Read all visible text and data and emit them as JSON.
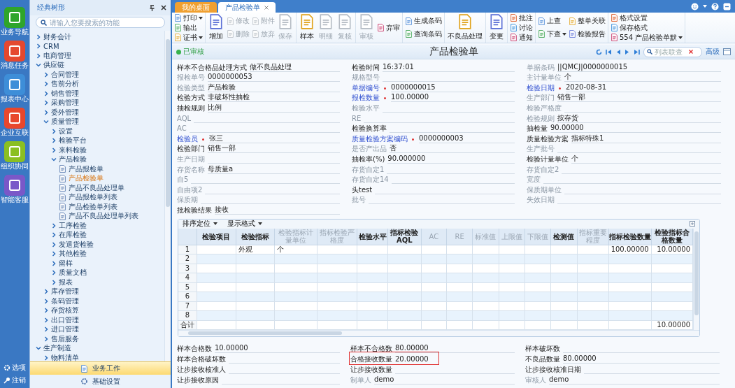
{
  "rail": {
    "items": [
      {
        "label": "业务导航",
        "color": "#2fa52a"
      },
      {
        "label": "消息任务",
        "color": "#e5482f"
      },
      {
        "label": "报表中心",
        "color": "#3e8ed8"
      },
      {
        "label": "企业互联",
        "color": "#e8472c"
      },
      {
        "label": "组织协同",
        "color": "#8bbf22"
      },
      {
        "label": "智能客服",
        "color": "#7a58c8"
      }
    ],
    "footer": [
      {
        "label": "选项",
        "kind": "gear"
      },
      {
        "label": "注销",
        "kind": "key"
      }
    ]
  },
  "tree_panel": {
    "title": "经典树形",
    "search": {
      "placeholder": "请输入您要搜索的功能"
    },
    "items": [
      {
        "label": "财务会计",
        "kind": "folder",
        "expanded": false,
        "selected": false
      },
      {
        "label": "CRM",
        "kind": "folder",
        "expanded": false,
        "selected": false
      },
      {
        "label": "电商管理",
        "kind": "folder",
        "expanded": false,
        "selected": false
      },
      {
        "label": "供应链",
        "kind": "folder",
        "expanded": true,
        "selected": false,
        "children": [
          {
            "label": "合同管理",
            "kind": "folder",
            "expanded": false,
            "selected": false
          },
          {
            "label": "售前分析",
            "kind": "folder",
            "expanded": false,
            "selected": false
          },
          {
            "label": "销售管理",
            "kind": "folder",
            "expanded": false,
            "selected": false
          },
          {
            "label": "采购管理",
            "kind": "folder",
            "expanded": false,
            "selected": false
          },
          {
            "label": "委外管理",
            "kind": "folder",
            "expanded": false,
            "selected": false
          },
          {
            "label": "质量管理",
            "kind": "folder",
            "expanded": true,
            "selected": false,
            "children": [
              {
                "label": "设置",
                "kind": "folder",
                "expanded": false,
                "selected": false
              },
              {
                "label": "检验平台",
                "kind": "folder",
                "expanded": false,
                "selected": false
              },
              {
                "label": "来料检验",
                "kind": "folder",
                "expanded": false,
                "selected": false
              },
              {
                "label": "产品检验",
                "kind": "folder",
                "expanded": true,
                "selected": false,
                "children": [
                  {
                    "label": "产品报检单",
                    "kind": "document",
                    "selected": false
                  },
                  {
                    "label": "产品检验单",
                    "kind": "document",
                    "selected": true
                  },
                  {
                    "label": "产品不良品处理单",
                    "kind": "document",
                    "selected": false
                  },
                  {
                    "label": "产品报检单列表",
                    "kind": "document",
                    "selected": false
                  },
                  {
                    "label": "产品检验单列表",
                    "kind": "document",
                    "selected": false
                  },
                  {
                    "label": "产品不良品处理单列表",
                    "kind": "document",
                    "selected": false
                  }
                ]
              },
              {
                "label": "工序检验",
                "kind": "folder",
                "expanded": false,
                "selected": false
              },
              {
                "label": "在库检验",
                "kind": "folder",
                "expanded": false,
                "selected": false
              },
              {
                "label": "发退货检验",
                "kind": "folder",
                "expanded": false,
                "selected": false
              },
              {
                "label": "其他检验",
                "kind": "folder",
                "expanded": false,
                "selected": false
              },
              {
                "label": "留样",
                "kind": "folder",
                "expanded": false,
                "selected": false
              },
              {
                "label": "质量文档",
                "kind": "folder",
                "expanded": false,
                "selected": false
              },
              {
                "label": "报表",
                "kind": "folder",
                "expanded": false,
                "selected": false
              }
            ]
          },
          {
            "label": "库存管理",
            "kind": "folder",
            "expanded": false,
            "selected": false
          },
          {
            "label": "条码管理",
            "kind": "folder",
            "expanded": false,
            "selected": false
          },
          {
            "label": "存货核算",
            "kind": "folder",
            "expanded": false,
            "selected": false
          },
          {
            "label": "出口管理",
            "kind": "folder",
            "expanded": false,
            "selected": false
          },
          {
            "label": "进口管理",
            "kind": "folder",
            "expanded": false,
            "selected": false
          },
          {
            "label": "售后服务",
            "kind": "folder",
            "expanded": false,
            "selected": false
          }
        ]
      },
      {
        "label": "生产制造",
        "kind": "folder",
        "expanded": true,
        "selected": false,
        "children": [
          {
            "label": "物料清单",
            "kind": "folder",
            "expanded": false,
            "selected": false
          }
        ]
      }
    ],
    "buttons": [
      {
        "label": "业务工作",
        "selected": true
      },
      {
        "label": "基础设置",
        "selected": false
      }
    ]
  },
  "tabs": [
    {
      "label": "我的桌面",
      "selected": false
    },
    {
      "label": "产品检验单",
      "selected": true
    }
  ],
  "toolbar": [
    [
      [
        {
          "label": "打印",
          "kind": "menu",
          "disabled": false
        },
        {
          "label": "输出",
          "kind": "small",
          "disabled": false
        },
        {
          "label": "证书",
          "kind": "menu",
          "disabled": false
        }
      ]
    ],
    [
      [
        {
          "label": "增加",
          "kind": "big",
          "disabled": false
        }
      ],
      [
        {
          "label": "修改",
          "kind": "small",
          "disabled": true
        },
        {
          "label": "删除",
          "kind": "small",
          "disabled": true
        }
      ],
      [
        {
          "label": "附件",
          "kind": "small",
          "disabled": true
        },
        {
          "label": "放弃",
          "kind": "small",
          "disabled": true
        }
      ],
      [
        {
          "label": "保存",
          "kind": "big",
          "disabled": true
        }
      ]
    ],
    [
      [
        {
          "label": "样本",
          "kind": "big",
          "disabled": false
        }
      ],
      [
        {
          "label": "明细",
          "kind": "big",
          "disabled": true
        }
      ],
      [
        {
          "label": "复核",
          "kind": "big",
          "disabled": true
        }
      ]
    ],
    [
      [
        {
          "label": "审核",
          "kind": "big",
          "disabled": true
        }
      ],
      [
        {
          "label": "弃审",
          "kind": "small",
          "disabled": false
        }
      ]
    ],
    [
      [
        {
          "label": "生成条码",
          "kind": "small",
          "disabled": false
        },
        {
          "label": "查询条码",
          "kind": "small",
          "disabled": false
        }
      ]
    ],
    [
      [
        {
          "label": "不良品处理",
          "kind": "big",
          "disabled": false
        }
      ]
    ],
    [
      [
        {
          "label": "变更",
          "kind": "big",
          "disabled": false
        }
      ]
    ],
    [
      [
        {
          "label": "批注",
          "kind": "small",
          "disabled": false
        },
        {
          "label": "讨论",
          "kind": "small",
          "disabled": false
        },
        {
          "label": "通知",
          "kind": "small",
          "disabled": false
        }
      ]
    ],
    [
      [
        {
          "label": "上查",
          "kind": "small",
          "disabled": false
        },
        {
          "label": "下查",
          "kind": "menu",
          "disabled": false
        }
      ],
      [
        {
          "label": "整单关联",
          "kind": "small",
          "disabled": false
        },
        {
          "label": "检验报告",
          "kind": "small",
          "disabled": false
        }
      ]
    ],
    [
      [
        {
          "label": "格式设置",
          "kind": "small",
          "disabled": false
        },
        {
          "label": "保存格式",
          "kind": "small",
          "disabled": false
        },
        {
          "label": "554 产品检验单默",
          "kind": "menu",
          "disabled": false
        }
      ]
    ]
  ],
  "title_bar": {
    "status": "已审核",
    "title": "产品检验单",
    "search": {
      "placeholder": "列表联查"
    },
    "advanced": "高级"
  },
  "form": {
    "columns": [
      [
        {
          "label": "样本不合格品处理方式",
          "value": "做不良品处理",
          "kind": "strong"
        },
        {
          "label": "报检单号",
          "value": "0000000053",
          "kind": "plain"
        },
        {
          "label": "检验类型",
          "value": "产品检验",
          "kind": "plain"
        },
        {
          "label": "检验方式",
          "value": "非破坏性抽检",
          "kind": "strong"
        },
        {
          "label": "抽检规则",
          "value": "比例",
          "kind": "strong"
        },
        {
          "label": "AQL",
          "kind": "plain"
        },
        {
          "label": "AC",
          "kind": "plain"
        },
        {
          "label": "检验员",
          "value": "张三",
          "kind": "required"
        },
        {
          "label": "检验部门",
          "value": "销售一部",
          "kind": "strong"
        },
        {
          "label": "生产日期",
          "kind": "plain"
        },
        {
          "label": "存货名称",
          "value": "母质量a",
          "kind": "plain"
        },
        {
          "label": "自5",
          "kind": "plain"
        },
        {
          "label": "自由项2",
          "kind": "plain"
        },
        {
          "label": "保质期",
          "kind": "plain"
        },
        {
          "label": "批检验结果",
          "value": "接收",
          "kind": "strong"
        }
      ],
      [
        {
          "label": "检验时间",
          "value": "16:37:01",
          "kind": "strong"
        },
        {
          "label": "规格型号",
          "kind": "plain"
        },
        {
          "label": "单据编号",
          "value": "0000000015",
          "kind": "required"
        },
        {
          "label": "报检数量",
          "value": "100.00000",
          "kind": "required"
        },
        {
          "label": "检验水平",
          "kind": "plain"
        },
        {
          "label": "RE",
          "kind": "plain"
        },
        {
          "label": "检验换算率",
          "kind": "strong"
        },
        {
          "label": "质量检验方案编码",
          "value": "0000000003",
          "kind": "required"
        },
        {
          "label": "是否产出品",
          "value": "否",
          "kind": "plain"
        },
        {
          "label": "抽检率(%)",
          "value": "90.000000",
          "kind": "strong"
        },
        {
          "label": "存货自定1",
          "kind": "plain"
        },
        {
          "label": "存货自定14",
          "kind": "plain"
        },
        {
          "label": "头test",
          "kind": "strong"
        },
        {
          "label": "批号",
          "kind": "plain"
        }
      ],
      [
        {
          "label": "单据条码",
          "value": "||QMCJ|0000000015",
          "kind": "plain"
        },
        {
          "label": "主计量单位",
          "value": "个",
          "kind": "plain"
        },
        {
          "label": "检验日期",
          "value": "2020-08-31",
          "kind": "required"
        },
        {
          "label": "生产部门",
          "value": "销售一部",
          "kind": "plain"
        },
        {
          "label": "检验严格度",
          "kind": "plain"
        },
        {
          "label": "检验规则",
          "value": "按存货",
          "kind": "plain"
        },
        {
          "label": "抽检量",
          "value": "90.00000",
          "kind": "strong"
        },
        {
          "label": "质量检验方案",
          "value": "指标特殊1",
          "kind": "strong"
        },
        {
          "label": "生产批号",
          "kind": "plain"
        },
        {
          "label": "检验计量单位",
          "value": "个",
          "kind": "strong"
        },
        {
          "label": "存货自定2",
          "kind": "plain"
        },
        {
          "label": "宽度",
          "kind": "plain"
        },
        {
          "label": "保质期单位",
          "kind": "plain"
        },
        {
          "label": "失效日期",
          "kind": "plain"
        }
      ]
    ]
  },
  "table": {
    "toolbar": [
      "排序定位",
      "显示格式"
    ],
    "columns": [
      {
        "label": "检验项目",
        "disabled": false
      },
      {
        "label": "检验指标",
        "disabled": false
      },
      {
        "label": "检验指标计量单位",
        "disabled": true
      },
      {
        "label": "指标检验严格度",
        "disabled": true
      },
      {
        "label": "检验水平",
        "disabled": false
      },
      {
        "label": "指标检验AQL",
        "disabled": false
      },
      {
        "label": "AC",
        "disabled": true
      },
      {
        "label": "RE",
        "disabled": true
      },
      {
        "label": "标准值",
        "disabled": true
      },
      {
        "label": "上限值",
        "disabled": true
      },
      {
        "label": "下限值",
        "disabled": true
      },
      {
        "label": "检测值",
        "disabled": false
      },
      {
        "label": "指标重要程度",
        "disabled": true
      },
      {
        "label": "指标检验数量",
        "disabled": false
      },
      {
        "label": "检验指标合格数量",
        "disabled": false
      }
    ],
    "rows": [
      {
        "number": "1",
        "cells": [
          null,
          "外观",
          "个",
          null,
          null,
          null,
          null,
          null,
          null,
          null,
          null,
          null,
          null,
          "100.00000",
          "10.00000"
        ]
      },
      {
        "number": "2"
      },
      {
        "number": "3"
      },
      {
        "number": "4"
      },
      {
        "number": "5"
      },
      {
        "number": "6"
      },
      {
        "number": "7"
      },
      {
        "number": "8"
      }
    ],
    "footer": {
      "label": "合计",
      "cells": [
        null,
        null,
        null,
        null,
        null,
        null,
        null,
        null,
        null,
        null,
        null,
        null,
        null,
        null,
        "10.00000"
      ]
    }
  },
  "summary": {
    "columns": [
      [
        {
          "label": "样本合格数",
          "value": "10.00000",
          "kind": "strong",
          "highlighted": false
        },
        {
          "label": "样本合格破坏数",
          "kind": "strong",
          "highlighted": false
        },
        {
          "label": "让步接收核准人",
          "kind": "strong",
          "highlighted": false
        },
        {
          "label": "让步接收原因",
          "kind": "strong",
          "highlighted": false
        }
      ],
      [
        {
          "label": "样本不合格数",
          "value": "80.00000",
          "kind": "strong",
          "highlighted": false
        },
        {
          "label": "合格接收数量",
          "value": "20.00000",
          "kind": "strong",
          "highlighted": true
        },
        {
          "label": "让步接收数量",
          "kind": "strong",
          "highlighted": false
        },
        {
          "label": "制单人",
          "value": "demo",
          "kind": "plain",
          "highlighted": false
        }
      ],
      [
        {
          "label": "样本破坏数",
          "kind": "strong",
          "highlighted": false
        },
        {
          "label": "不良品数量",
          "value": "80.00000",
          "kind": "strong",
          "highlighted": false
        },
        {
          "label": "让步接收核准日期",
          "kind": "strong",
          "highlighted": false
        },
        {
          "label": "审核人",
          "value": "demo",
          "kind": "plain",
          "highlighted": false
        }
      ]
    ]
  }
}
